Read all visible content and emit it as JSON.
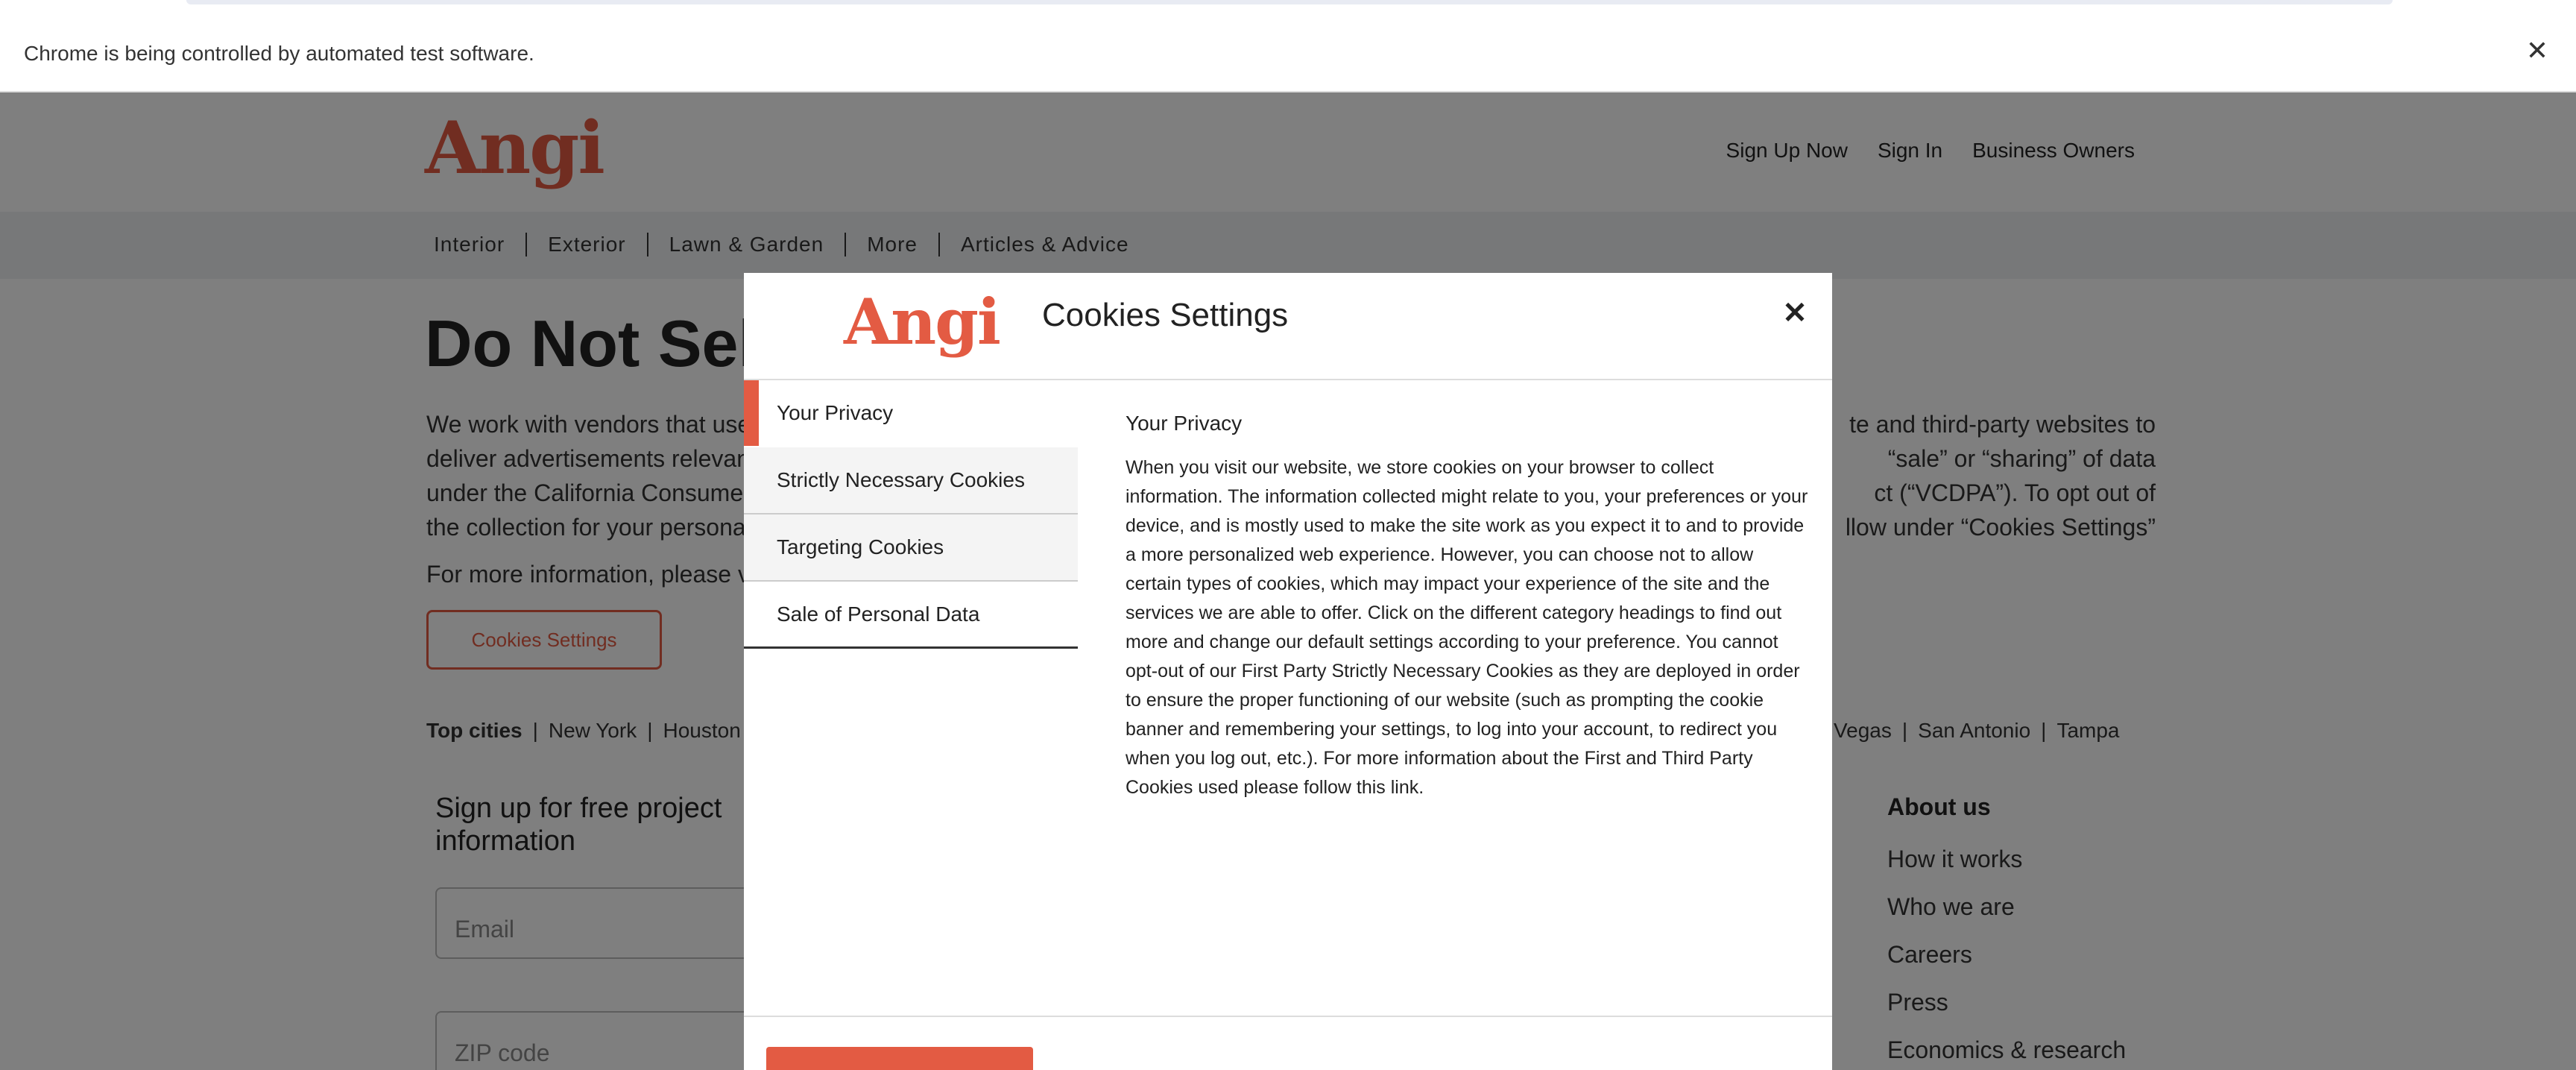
{
  "chrome": {
    "automation_message": "Chrome is being controlled by automated test software.",
    "close_glyph": "✕"
  },
  "header": {
    "logo": "Angi",
    "links": [
      "Sign Up Now",
      "Sign In",
      "Business Owners"
    ]
  },
  "subnav": {
    "items": [
      "Interior",
      "Exterior",
      "Lawn & Garden",
      "More",
      "Articles & Advice"
    ]
  },
  "page": {
    "title": "Do Not Sell",
    "intro_lines": [
      "We work with vendors that use",
      "deliver advertisements relevan",
      "under the California Consume",
      "the collection for your persona"
    ],
    "intro_right_lines": [
      "te and third-party websites to",
      "“sale” or “sharing” of data",
      "ct (“VCDPA”). To opt out of",
      "llow under “Cookies Settings”"
    ],
    "more_info": "For more information, please v",
    "cookies_button": "Cookies Settings",
    "top_cities_label": "Top cities",
    "cities_left": [
      "New York",
      "Houston"
    ],
    "cities_right": [
      "Vegas",
      "San Antonio",
      "Tampa"
    ],
    "signup_title": "Sign up for free project information",
    "email_placeholder": "Email",
    "zip_placeholder": "ZIP code",
    "about_title": "About us",
    "about_links": [
      "How it works",
      "Who we are",
      "Careers",
      "Press",
      "Economics & research"
    ]
  },
  "modal": {
    "logo": "Angi",
    "title": "Cookies Settings",
    "close_glyph": "✕",
    "menu": [
      "Your Privacy",
      "Strictly Necessary Cookies",
      "Targeting Cookies",
      "Sale of Personal Data"
    ],
    "content_title": "Your Privacy",
    "content_body": "When you visit our website, we store cookies on your browser to collect information. The information collected might relate to you, your preferences or your device, and is mostly used to make the site work as you expect it to and to provide a more personalized web experience. However, you can choose not to allow certain types of cookies, which may impact your experience of the site and the services we are able to offer. Click on the different category headings to find out more and change our default settings according to your preference. You cannot opt-out of our First Party Strictly Necessary Cookies as they are deployed in order to ensure the proper functioning of our website (such as prompting the cookie banner and remembering your settings, to log into your account, to redirect you when you log out, etc.). For more information about the First and Third Party Cookies used please follow this link."
  },
  "colors": {
    "brand": "#e35b43",
    "overlay": "rgba(0,0,0,0.5)"
  }
}
